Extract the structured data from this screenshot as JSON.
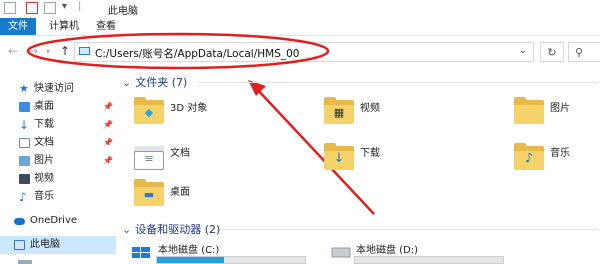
{
  "window": {
    "title": "此电脑"
  },
  "ribbon": {
    "tabs": [
      "文件",
      "计算机",
      "查看"
    ]
  },
  "nav": {
    "address": "C:/Users/账号名/AppData/Local/HMS_00"
  },
  "sidebar": {
    "items": [
      {
        "label": "快速访问",
        "icon": "star-icon",
        "pinned": false
      },
      {
        "label": "桌面",
        "icon": "desktop-icon",
        "pinned": true
      },
      {
        "label": "下载",
        "icon": "download-icon",
        "pinned": true
      },
      {
        "label": "文档",
        "icon": "document-icon",
        "pinned": true
      },
      {
        "label": "图片",
        "icon": "pictures-icon",
        "pinned": true
      },
      {
        "label": "视频",
        "icon": "video-icon",
        "pinned": false
      },
      {
        "label": "音乐",
        "icon": "music-icon",
        "pinned": false
      },
      {
        "label": "OneDrive",
        "icon": "cloud-icon",
        "pinned": false
      },
      {
        "label": "此电脑",
        "icon": "computer-icon",
        "pinned": false,
        "selected": true
      }
    ]
  },
  "folders_section": {
    "title": "文件夹 (7)",
    "items": [
      {
        "label": "3D 对象",
        "icon": "cube-icon"
      },
      {
        "label": "视频",
        "icon": "video-icon"
      },
      {
        "label": "图片",
        "icon": "pictures-icon"
      },
      {
        "label": "文档",
        "icon": "document-icon"
      },
      {
        "label": "下载",
        "icon": "download-icon"
      },
      {
        "label": "音乐",
        "icon": "music-icon"
      },
      {
        "label": "桌面",
        "icon": "desktop-icon"
      }
    ]
  },
  "drives_section": {
    "title": "设备和驱动器 (2)",
    "drives": [
      {
        "label": "本地磁盘 (C:)",
        "used_fraction": 0.45
      },
      {
        "label": "本地磁盘 (D:)",
        "used_fraction": 0.0
      }
    ]
  },
  "colors": {
    "accent": "#1979ca",
    "annotation": "#e02020",
    "folder": "#f6d36a"
  }
}
